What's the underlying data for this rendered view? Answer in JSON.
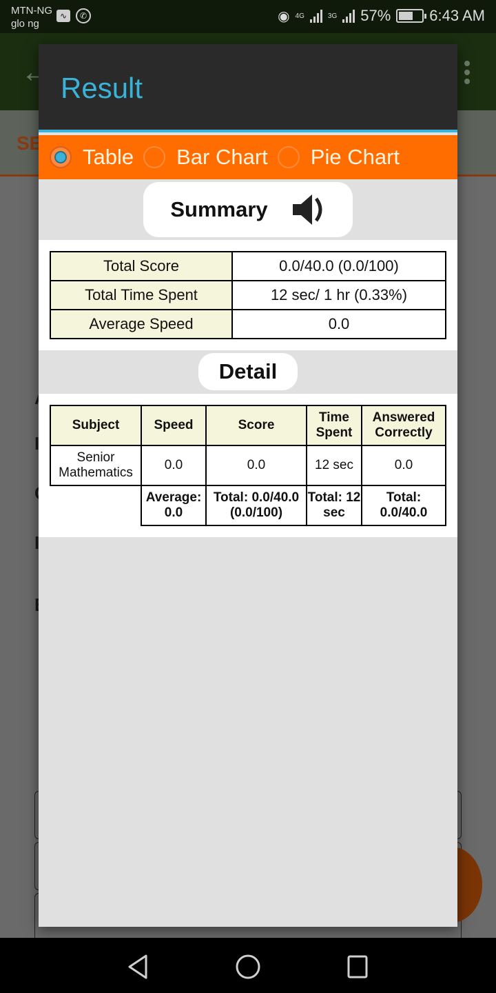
{
  "status_bar": {
    "carrier_1": "MTN-NG",
    "carrier_2": "glo ng",
    "left_icons": [
      "activity-icon",
      "whatsapp-icon"
    ],
    "network_1": "4G",
    "network_2": "3G",
    "battery": "57%",
    "time": "6:43 AM"
  },
  "background_app": {
    "partial_tab_text": "SE",
    "partial_letters": [
      "A",
      "I",
      "C",
      "I",
      "E"
    ]
  },
  "dialog": {
    "title": "Result",
    "view_options": [
      {
        "label": "Table",
        "selected": true
      },
      {
        "label": "Bar Chart",
        "selected": false
      },
      {
        "label": "Pie Chart",
        "selected": false
      }
    ],
    "summary": {
      "heading": "Summary",
      "speaker_icon": "speaker-icon",
      "rows": [
        {
          "label": "Total Score",
          "value": "0.0/40.0 (0.0/100)"
        },
        {
          "label": "Total Time Spent",
          "value": "12 sec/ 1 hr (0.33%)"
        },
        {
          "label": "Average Speed",
          "value": "0.0"
        }
      ]
    },
    "detail": {
      "heading": "Detail",
      "columns": [
        "Subject",
        "Speed",
        "Score",
        "Time Spent",
        "Answered Correctly"
      ],
      "rows": [
        {
          "subject": "Senior Mathematics",
          "speed": "0.0",
          "score": "0.0",
          "time_spent": "12 sec",
          "answered_correctly": "0.0"
        }
      ],
      "totals": {
        "speed": "Average: 0.0",
        "score": "Total: 0.0/40.0 (0.0/100)",
        "time_spent": "Total: 12 sec",
        "answered_correctly": "Total: 0.0/40.0"
      }
    }
  },
  "nav_bar": {
    "buttons": [
      "back",
      "home",
      "recents"
    ]
  }
}
